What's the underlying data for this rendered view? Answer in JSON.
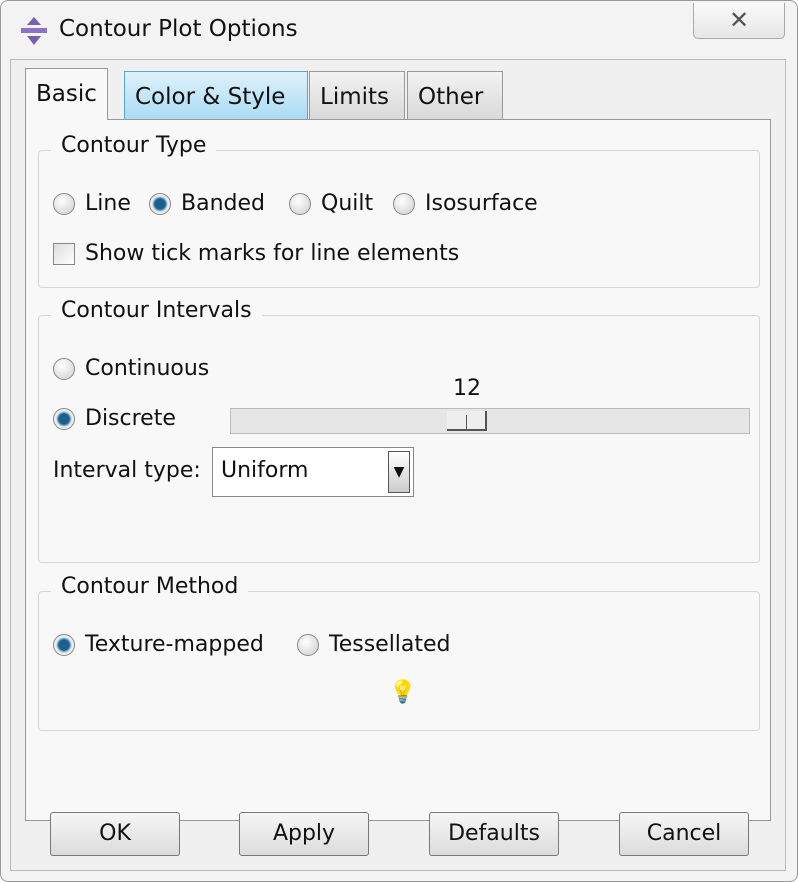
{
  "window": {
    "title": "Contour Plot Options",
    "close_icon": "x-icon"
  },
  "tabs": [
    {
      "label": "Basic",
      "active": true
    },
    {
      "label": "Color & Style"
    },
    {
      "label": "Limits"
    },
    {
      "label": "Other"
    }
  ],
  "contour_type": {
    "label": "Contour Type",
    "options": [
      "Line",
      "Banded",
      "Quilt",
      "Isosurface"
    ],
    "selected": "Banded",
    "tick_marks_label": "Show tick marks for line elements",
    "tick_marks_checked": false
  },
  "contour_intervals": {
    "label": "Contour Intervals",
    "continuous_label": "Continuous",
    "discrete_label": "Discrete",
    "selected": "Discrete",
    "slider_value": "12",
    "interval_type_label": "Interval type:",
    "interval_type_value": "Uniform"
  },
  "contour_method": {
    "label": "Contour Method",
    "options": [
      "Texture-mapped",
      "Tessellated"
    ],
    "selected": "Texture-mapped",
    "tip_icon": "lightbulb-icon"
  },
  "buttons": {
    "ok": "OK",
    "apply": "Apply",
    "defaults": "Defaults",
    "cancel": "Cancel"
  }
}
